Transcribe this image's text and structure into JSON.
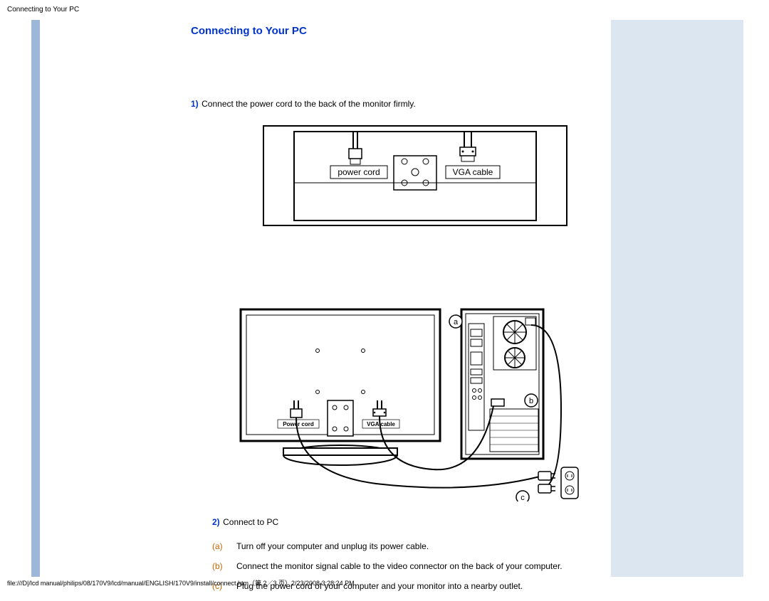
{
  "header": "Connecting to Your PC",
  "title": "Connecting to Your PC",
  "step1": {
    "num": "1)",
    "text": " Connect the power cord to the back of the monitor firmly."
  },
  "diagram1": {
    "power_label": "power cord",
    "vga_label": "VGA cable"
  },
  "diagram2": {
    "power_label": "Power cord",
    "vga_label": "VGA cable",
    "a": "a",
    "b": "b",
    "c": "c"
  },
  "step2": {
    "num": "2)",
    "text": " Connect to PC"
  },
  "substeps": [
    {
      "letter": "(a)",
      "text": "Turn off your computer and unplug its power cable."
    },
    {
      "letter": "(b)",
      "text": "Connect the monitor signal cable to the video connector on the back of your computer."
    },
    {
      "letter": "(c)",
      "text": "Plug the power cord of your computer and your monitor into a nearby outlet."
    }
  ],
  "footer": "file:///D|/lcd manual/philips/08/170V9/lcd/manual/ENGLISH/170V9/install/connect.htm（第 2／3 页）2/23/2008 3:28:24 PM"
}
